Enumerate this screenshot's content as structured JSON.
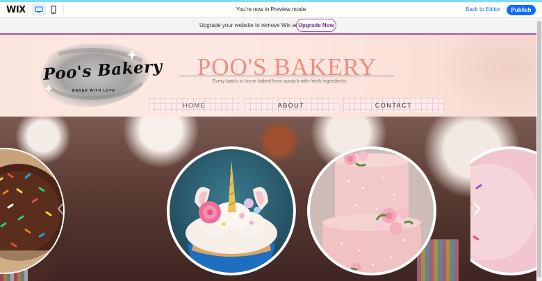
{
  "editor_bar": {
    "logo": "WIX",
    "preview_message": "You're now in Preview mode",
    "back_to_editor": "Back to Editor",
    "publish": "Publish",
    "devices": [
      "desktop-icon",
      "mobile-icon"
    ],
    "accent_color": "#116dff"
  },
  "upgrade_bar": {
    "message": "Upgrade your website to remove Wix ads",
    "button": "Upgrade Now",
    "accent_color": "#b24aa0"
  },
  "header": {
    "logo_text": "Poo's Bakery",
    "logo_tagline": "BAKED WITH LOVE",
    "title": "POO'S BAKERY",
    "tagline": "Every batch is home baked from scratch with fresh ingredients.",
    "title_color": "#f08c82"
  },
  "nav": {
    "items": [
      {
        "label": "HOME"
      },
      {
        "label": "ABOUT"
      },
      {
        "label": "CONTACT"
      }
    ]
  },
  "gallery": {
    "items": [
      "Sprinkle donut",
      "Unicorn cupcake",
      "Pink rose cake",
      "Pink sprinkle treat"
    ],
    "prev_icon": "chevron-left-icon",
    "next_icon": "chevron-right-icon"
  }
}
